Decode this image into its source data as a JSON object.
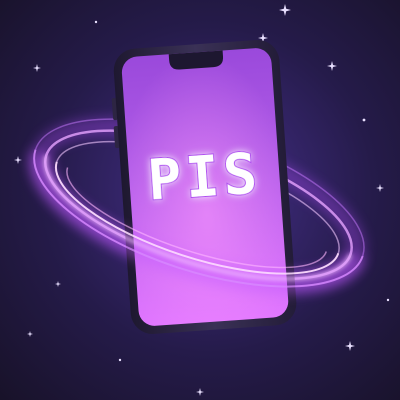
{
  "logo": {
    "text": "PIS"
  },
  "colors": {
    "background": "#251b4a",
    "background_edge": "#181229",
    "phone_frame": "#2a2340",
    "screen_top": "#a54fe0",
    "screen_bottom": "#d66cff",
    "glow_ring": "#e08bff",
    "star": "#e9e0ff",
    "logo_text": "#ffffff"
  },
  "icons": {
    "stars": "sparkle-icon",
    "device": "smartphone-icon",
    "ring": "orbit-ring-icon"
  }
}
